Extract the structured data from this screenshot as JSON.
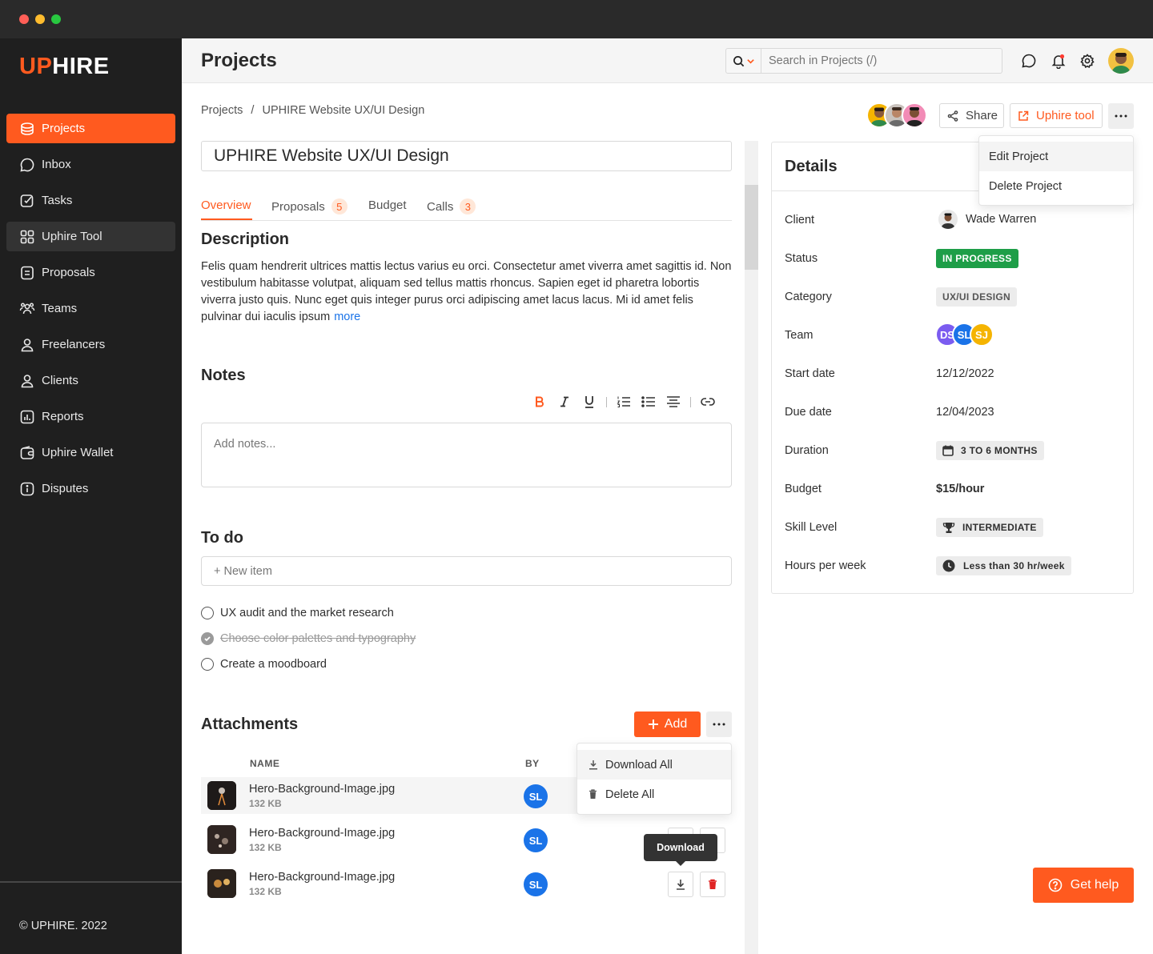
{
  "window": {
    "dots": [
      "#ff5f57",
      "#febc2e",
      "#28c840"
    ]
  },
  "brand": {
    "logo_up": "UP",
    "logo_hire": "HIRE",
    "accent": "#ff5a1f"
  },
  "sidebar": {
    "items": [
      {
        "label": "Projects",
        "icon": "projects-icon"
      },
      {
        "label": "Inbox",
        "icon": "chat-icon"
      },
      {
        "label": "Tasks",
        "icon": "tasks-icon"
      },
      {
        "label": "Uphire Tool",
        "icon": "grid-icon"
      },
      {
        "label": "Proposals",
        "icon": "document-icon"
      },
      {
        "label": "Teams",
        "icon": "team-icon"
      },
      {
        "label": "Freelancers",
        "icon": "user-icon"
      },
      {
        "label": "Clients",
        "icon": "user-icon"
      },
      {
        "label": "Reports",
        "icon": "chart-icon"
      },
      {
        "label": "Uphire Wallet",
        "icon": "wallet-icon"
      },
      {
        "label": "Disputes",
        "icon": "info-icon"
      }
    ],
    "copyright": "© UPHIRE. 2022"
  },
  "header": {
    "title": "Projects",
    "search_placeholder": "Search in Projects (/)"
  },
  "breadcrumb": {
    "root": "Projects",
    "sep": "/",
    "current": "UPHIRE Website UX/UI Design"
  },
  "actions": {
    "share": "Share",
    "tool": "Uphire tool"
  },
  "project_menu": {
    "edit": "Edit Project",
    "delete": "Delete Project"
  },
  "project": {
    "title": "UPHIRE Website UX/UI Design",
    "tabs": [
      {
        "label": "Overview",
        "badge": ""
      },
      {
        "label": "Proposals",
        "badge": "5"
      },
      {
        "label": "Budget",
        "badge": ""
      },
      {
        "label": "Calls",
        "badge": "3"
      }
    ],
    "description_title": "Description",
    "description": "Felis quam hendrerit ultrices mattis lectus varius eu orci. Consectetur amet viverra amet sagittis id. Non vestibulum habitasse volutpat, aliquam sed tellus mattis rhoncus. Sapien eget id pharetra lobortis viverra justo quis. Nunc eget quis integer purus orci adipiscing amet lacus lacus. Mi id amet felis pulvinar dui iaculis ipsum",
    "more": "more",
    "notes_title": "Notes",
    "notes_placeholder": "Add notes...",
    "todo_title": "To do",
    "new_item": "+ New item",
    "todos": [
      {
        "text": "UX audit and the market research",
        "done": false
      },
      {
        "text": "Choose color palettes and typography",
        "done": true
      },
      {
        "text": "Create a moodboard",
        "done": false
      }
    ]
  },
  "attachments": {
    "title": "Attachments",
    "add": "Add",
    "col_name": "NAME",
    "col_by": "BY",
    "rows": [
      {
        "name": "Hero-Background-Image.jpg",
        "size": "132 KB",
        "by": "SL"
      },
      {
        "name": "Hero-Background-Image.jpg",
        "size": "132 KB",
        "by": "SL"
      },
      {
        "name": "Hero-Background-Image.jpg",
        "size": "132 KB",
        "by": "SL"
      }
    ],
    "menu": {
      "download_all": "Download All",
      "delete_all": "Delete All"
    },
    "tooltip": "Download"
  },
  "details": {
    "title": "Details",
    "rows": [
      {
        "label": "Client",
        "value": "Wade Warren"
      },
      {
        "label": "Status",
        "value": "IN PROGRESS"
      },
      {
        "label": "Category",
        "value": "UX/UI DESIGN"
      },
      {
        "label": "Team",
        "value": ""
      },
      {
        "label": "Start date",
        "value": "12/12/2022"
      },
      {
        "label": "Due date",
        "value": "12/04/2023"
      },
      {
        "label": "Duration",
        "value": "3 TO 6 MONTHS"
      },
      {
        "label": "Budget",
        "value": "$15/hour"
      },
      {
        "label": "Skill Level",
        "value": "INTERMEDIATE"
      },
      {
        "label": "Hours per week",
        "value": "Less than 30 hr/week"
      }
    ],
    "team": [
      "DS",
      "SL",
      "SJ"
    ],
    "team_colors": [
      "#7b5cf0",
      "#1a73e8",
      "#f5b400"
    ],
    "status_color": "#1e9e48"
  },
  "help": {
    "label": "Get help"
  }
}
